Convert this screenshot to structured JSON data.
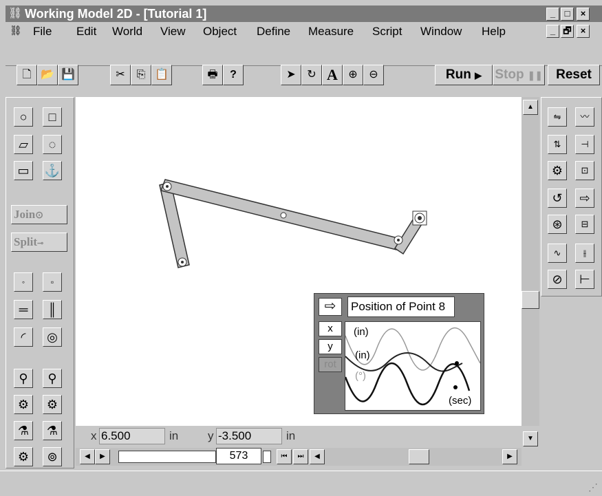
{
  "window": {
    "title": "Working Model 2D - [Tutorial 1]",
    "controls": [
      "_",
      "□",
      "×"
    ],
    "doc_controls": [
      "_",
      "🗗",
      "×"
    ]
  },
  "menu": [
    {
      "label": "File"
    },
    {
      "label": "Edit"
    },
    {
      "label": "World"
    },
    {
      "label": "View"
    },
    {
      "label": "Object"
    },
    {
      "label": "Define"
    },
    {
      "label": "Measure"
    },
    {
      "label": "Script"
    },
    {
      "label": "Window"
    },
    {
      "label": "Help"
    }
  ],
  "toolbar": {
    "run_label": "Run",
    "stop_label": "Stop",
    "reset_label": "Reset",
    "text_tool": "A"
  },
  "left_palette": {
    "join_label": "Join",
    "split_label": "Split"
  },
  "meter": {
    "title": "Position of Point 8",
    "tabs": [
      "x",
      "y",
      "rot"
    ],
    "labels": {
      "x_unit": "(in)",
      "y_unit": "(in)",
      "rot_unit": "(°)",
      "time_unit": "(sec)"
    }
  },
  "coords": {
    "x_label": "x",
    "x_value": "6.500",
    "x_unit": "in",
    "y_label": "y",
    "y_value": "-3.500",
    "y_unit": "in"
  },
  "frame_counter": "573",
  "colors": {
    "titlebar": "#7a7a7a",
    "chrome": "#c8c8c8",
    "link_fill": "#c0c0c0"
  }
}
